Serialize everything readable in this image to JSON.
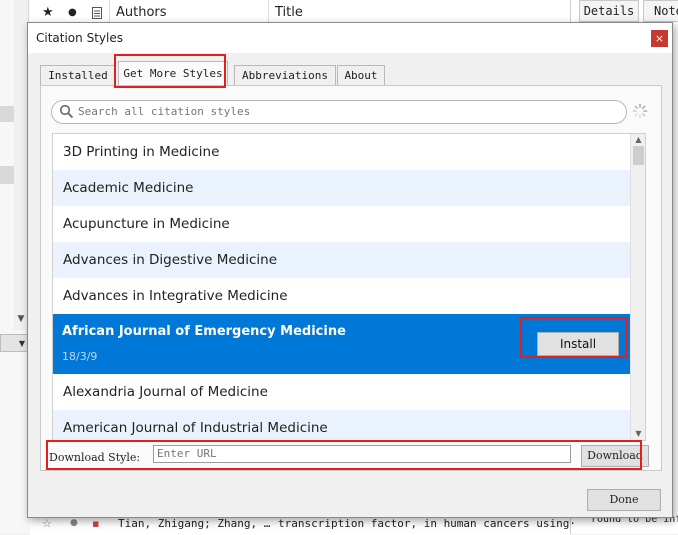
{
  "background": {
    "columns": {
      "authors": "Authors",
      "title": "Title"
    },
    "right_tabs": {
      "details": "Details",
      "notes": "Note"
    },
    "bottom_row": {
      "authors": "Tian, Zhigang; Zhang, …",
      "title": "transcription factor, in human cancers using·"
    },
    "right_bottom_text": "round to be inf"
  },
  "dialog": {
    "title": "Citation Styles",
    "close_glyph": "×",
    "tabs": [
      "Installed",
      "Get More Styles",
      "Abbreviations",
      "About"
    ],
    "search_placeholder": "Search all citation styles",
    "styles": [
      "3D Printing in Medicine",
      "Academic Medicine",
      "Acupuncture in Medicine",
      "Advances in Digestive Medicine",
      "Advances in Integrative Medicine",
      "African Journal of Emergency Medicine",
      "Alexandria Journal of Medicine",
      "American Journal of Industrial Medicine"
    ],
    "selected": {
      "name": "African Journal of Emergency Medicine",
      "date": "18/3/9",
      "install_label": "Install"
    },
    "download": {
      "label": "Download Style:",
      "placeholder": "Enter URL",
      "button": "Download"
    },
    "done_label": "Done"
  },
  "colors": {
    "selection": "#0078d7",
    "row_alt": "#eaf3fd",
    "highlight_box": "#e0201e",
    "close_button": "#c43a31"
  }
}
